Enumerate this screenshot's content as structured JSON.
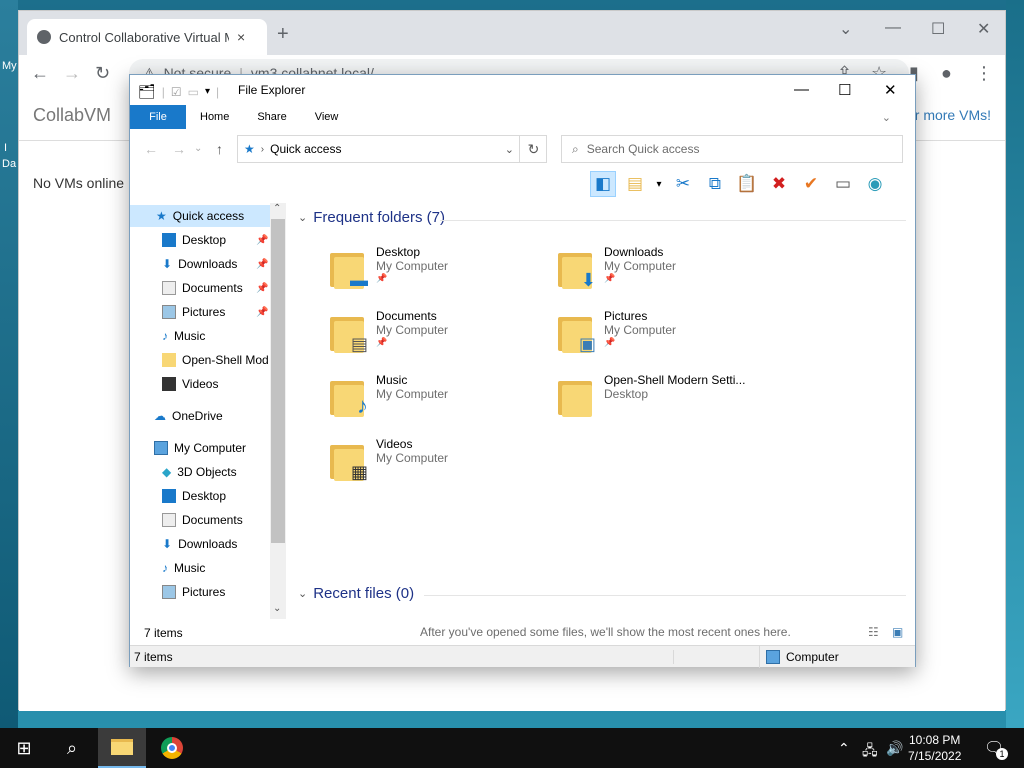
{
  "desktop": {
    "label_a": "My",
    "label_b": "I",
    "label_c": "Da"
  },
  "browser": {
    "tab_title": "Control Collaborative Virtual Mac",
    "tab_close": "×",
    "new_tab": "+",
    "win_minimize": "—",
    "win_maximize": "☐",
    "win_close": "✕",
    "security": "Not secure",
    "url": "vm3.collabnet.local/",
    "page": {
      "brand": "CollabVM",
      "more_link": "r more VMs!",
      "no_vms": "No VMs online"
    }
  },
  "explorer": {
    "title": "File Explorer",
    "ribbon_tabs": [
      "File",
      "Home",
      "Share",
      "View"
    ],
    "address": "Quick access",
    "search_placeholder": "Search Quick access",
    "nav": {
      "quick_access": "Quick access",
      "qa_items": [
        "Desktop",
        "Downloads",
        "Documents",
        "Pictures",
        "Music",
        "Open-Shell Mod",
        "Videos"
      ],
      "onedrive": "OneDrive",
      "computer": "My Computer",
      "computer_items": [
        "3D Objects",
        "Desktop",
        "Documents",
        "Downloads",
        "Music",
        "Pictures"
      ]
    },
    "frequent_header": "Frequent folders (7)",
    "frequent": [
      {
        "name": "Desktop",
        "location": "My Computer",
        "pinned": true,
        "icon": "desktop-icon"
      },
      {
        "name": "Downloads",
        "location": "My Computer",
        "pinned": true,
        "icon": "download-arrow-icon"
      },
      {
        "name": "Documents",
        "location": "My Computer",
        "pinned": true,
        "icon": "document-icon"
      },
      {
        "name": "Pictures",
        "location": "My Computer",
        "pinned": true,
        "icon": "picture-icon"
      },
      {
        "name": "Music",
        "location": "My Computer",
        "pinned": false,
        "icon": "music-note-icon"
      },
      {
        "name": "Open-Shell Modern Setti...",
        "location": "Desktop",
        "pinned": false,
        "icon": "folder-icon"
      },
      {
        "name": "Videos",
        "location": "My Computer",
        "pinned": false,
        "icon": "film-icon"
      }
    ],
    "recent_header": "Recent files (0)",
    "recent_empty": "After you've opened some files, we'll show the most recent ones here.",
    "items_count": "7 items",
    "status_items": "7 items",
    "status_location": "Computer"
  },
  "taskbar": {
    "time": "10:08 PM",
    "date": "7/15/2022",
    "notif_count": "1"
  },
  "colors": {
    "accent": "#1979ca",
    "folder": "#f8d775",
    "header_blue": "#1e3287"
  }
}
